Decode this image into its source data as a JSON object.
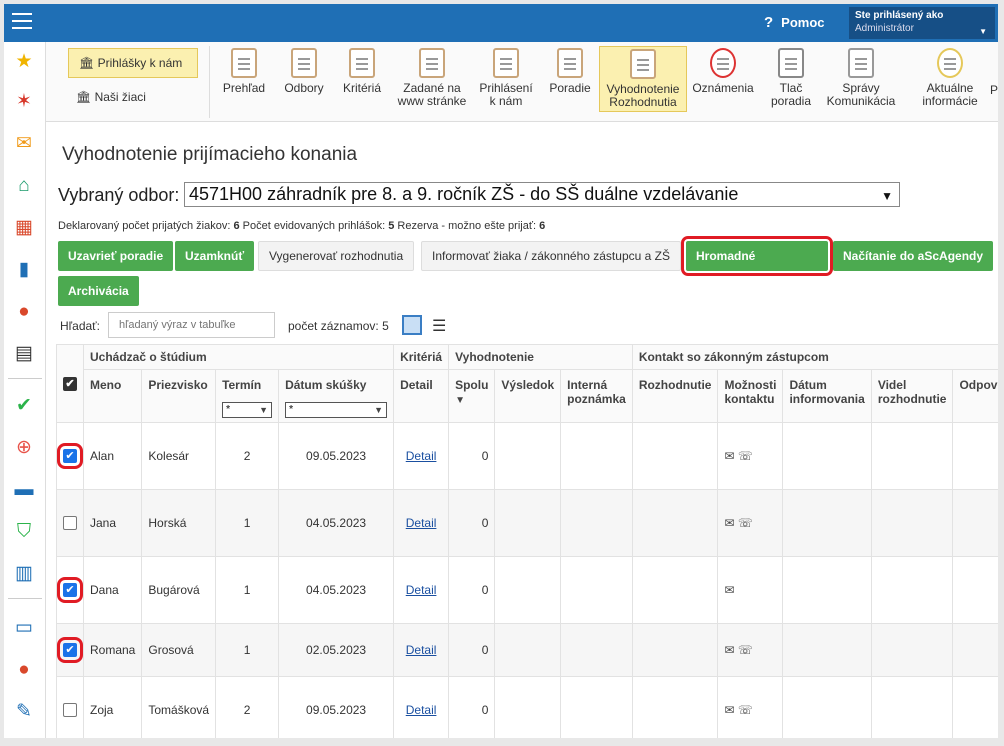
{
  "header": {
    "help_label": "Pomoc",
    "user_line1": "Ste prihlásený ako",
    "user_line2": "Administrátor"
  },
  "sidebar": {
    "icons": [
      "star-icon",
      "magic-wand-icon",
      "mail-icon",
      "home-icon",
      "calendar-icon",
      "book-icon",
      "user-icon",
      "calendar-grid-icon",
      "check-circle-icon",
      "badge-icon",
      "briefcase-icon",
      "shield-icon",
      "bar-chart-icon",
      "open-book-icon",
      "chat-icon",
      "feather-icon"
    ]
  },
  "toolbar": {
    "left_a": "Prihlášky k nám",
    "left_b": "Naši žiaci",
    "buttons": [
      {
        "label": "Prehľad"
      },
      {
        "label": "Odbory"
      },
      {
        "label": "Kritériá"
      },
      {
        "label": "Zadané na www stránke"
      },
      {
        "label": "Prihlásení k nám"
      },
      {
        "label": "Poradie"
      },
      {
        "label": "Vyhodnotenie Rozhodnutia"
      },
      {
        "label": "Oznámenia"
      },
      {
        "label": "Tlač poradia"
      },
      {
        "label": "Správy Komunikácia"
      },
      {
        "label": "Aktuálne informácie"
      },
      {
        "label": "P"
      }
    ]
  },
  "main": {
    "title": "Vyhodnotenie prijímacieho konania",
    "odbor_label": "Vybraný odbor:",
    "odbor_value": "4571H00 záhradník pre 8. a 9. ročník ZŠ - do SŠ duálne vzdelávanie",
    "stats": {
      "declared_label": "Deklarovaný počet prijatých žiakov:",
      "declared_value": "6",
      "registered_label": "Počet evidovaných prihlášok:",
      "registered_value": "5",
      "reserve_label": "Rezerva - možno ešte prijať:",
      "reserve_value": "6"
    },
    "buttons": {
      "close_order": "Uzavrieť poradie",
      "lock": "Uzamknúť",
      "generate": "Vygenerovať rozhodnutia",
      "inform": "Informovať žiaka / zákonného zástupcu a ZŠ",
      "bulk": "Hromadné nastavenie",
      "load": "Načítanie do aScAgendy",
      "archive": "Archivácia"
    },
    "search": {
      "label": "Hľadať:",
      "placeholder": "hľadaný výraz v tabuľke",
      "count_label": "počet záznamov:",
      "count_value": "5"
    }
  },
  "table": {
    "group_headers": {
      "applicant": "Uchádzač o štúdium",
      "criteria": "Kritériá",
      "evaluation": "Vyhodnotenie",
      "contact": "Kontakt so zákonným zástupcom"
    },
    "columns": {
      "name": "Meno",
      "surname": "Priezvisko",
      "term": "Termín",
      "exam_date": "Dátum skúšky",
      "detail": "Detail",
      "total": "Spolu",
      "result": "Výsledok",
      "note": "Interná poznámka",
      "decision": "Rozhodnutie",
      "contact_options": "Možnosti kontaktu",
      "info_date": "Dátum informovania",
      "seen_decision": "Videl rozhodnutie",
      "reply": "Odpove"
    },
    "filter_value": "*",
    "rows": [
      {
        "checked": true,
        "name": "Alan",
        "surname": "Kolesár",
        "term": "2",
        "date": "09.05.2023",
        "detail": "Detail",
        "total": "0",
        "contacts": "✉ ☏"
      },
      {
        "checked": false,
        "name": "Jana",
        "surname": "Horská",
        "term": "1",
        "date": "04.05.2023",
        "detail": "Detail",
        "total": "0",
        "contacts": "✉ ☏"
      },
      {
        "checked": true,
        "name": "Dana",
        "surname": "Bugárová",
        "term": "1",
        "date": "04.05.2023",
        "detail": "Detail",
        "total": "0",
        "contacts": "✉"
      },
      {
        "checked": true,
        "name": "Romana",
        "surname": "Grosová",
        "term": "1",
        "date": "02.05.2023",
        "detail": "Detail",
        "total": "0",
        "contacts": "✉ ☏"
      },
      {
        "checked": false,
        "name": "Zoja",
        "surname": "Tomášková",
        "term": "2",
        "date": "09.05.2023",
        "detail": "Detail",
        "total": "0",
        "contacts": "✉ ☏"
      }
    ]
  }
}
